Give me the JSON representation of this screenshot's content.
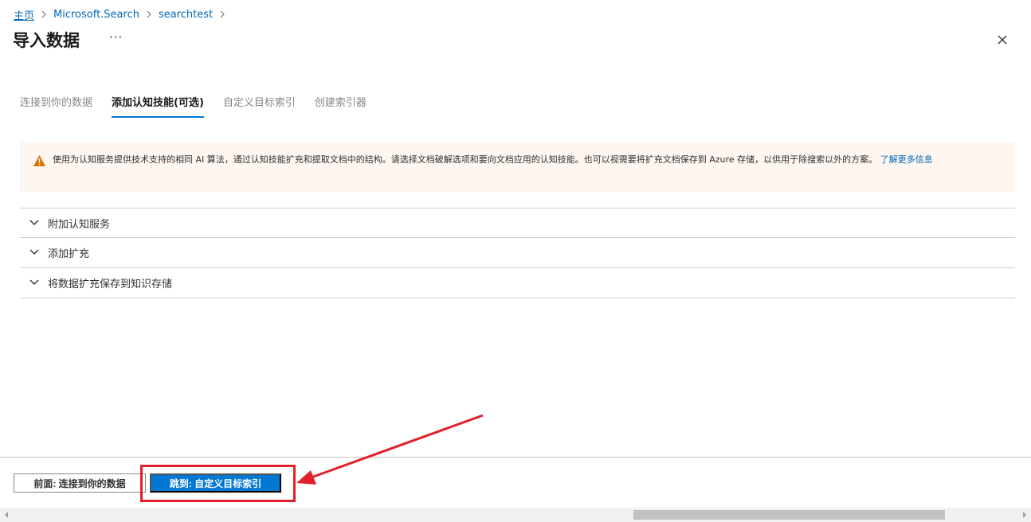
{
  "breadcrumb": {
    "home": "主页",
    "service": "Microsoft.Search",
    "resource": "searchtest"
  },
  "header": {
    "title": "导入数据",
    "more": "···"
  },
  "tabs": [
    {
      "label": "连接到你的数据",
      "state": "inactive"
    },
    {
      "label": "添加认知技能(可选)",
      "state": "active"
    },
    {
      "label": "自定义目标索引",
      "state": "inactive"
    },
    {
      "label": "创建索引器",
      "state": "inactive"
    }
  ],
  "warning": {
    "icon": "warning-triangle-icon",
    "text": "使用为认知服务提供技术支持的相同 AI 算法，通过认知技能扩充和提取文档中的结构。请选择文档破解选项和要向文档应用的认知技能。也可以视需要将扩充文档保存到 Azure 存储，以供用于除搜索以外的方案。",
    "link": "了解更多信息"
  },
  "sections": [
    {
      "label": "附加认知服务"
    },
    {
      "label": "添加扩充"
    },
    {
      "label": "将数据扩充保存到知识存储"
    }
  ],
  "footer": {
    "prev_label": "前面: 连接到你的数据",
    "next_label": "跳到: 自定义目标索引"
  },
  "colors": {
    "accent": "#0078d4",
    "link": "#0067b8",
    "warning_bg": "#fdf6f1",
    "warning_icon": "#d47500",
    "annotation_red": "#e0202a"
  }
}
